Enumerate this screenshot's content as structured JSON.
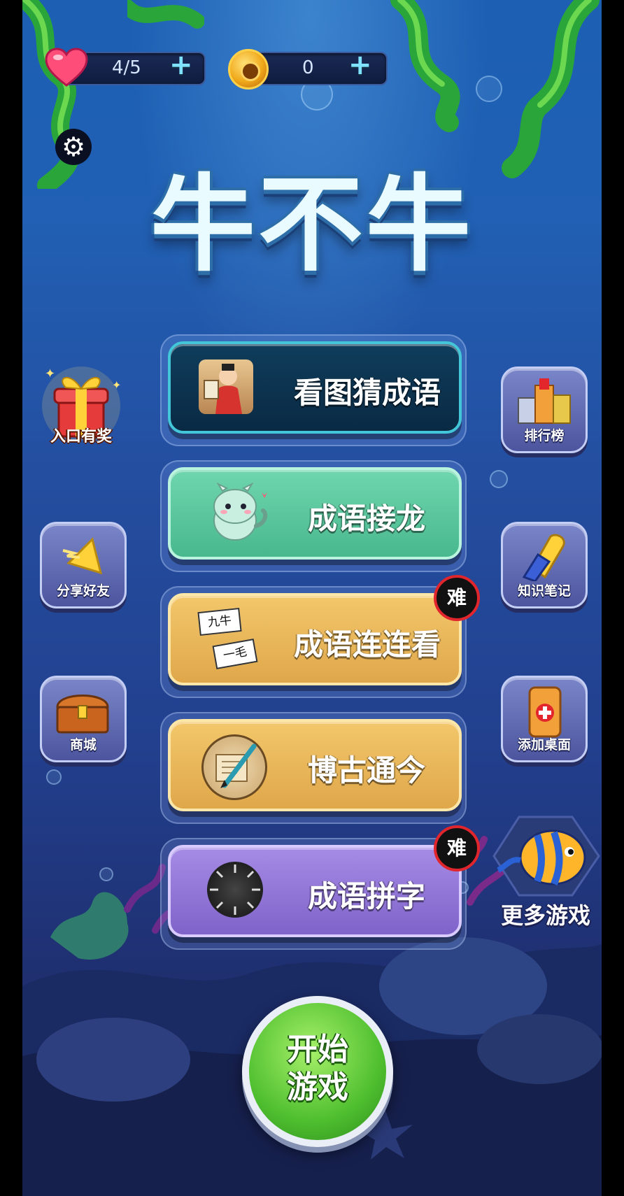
{
  "hud": {
    "lives": "4/5",
    "coins": "0",
    "plus_symbol": "+"
  },
  "title": "牛不牛",
  "settings_icon": "gear-icon",
  "menu": [
    {
      "label": "看图猜成语",
      "icon": "scholar-painting-icon",
      "color": "#0f3d5c"
    },
    {
      "label": "成语接龙",
      "icon": "baby-dragon-icon",
      "color": "#5ec79e"
    },
    {
      "label": "成语连连看",
      "icon": "word-cards-icon",
      "color": "#e9b75a",
      "badge": "难"
    },
    {
      "label": "博古通今",
      "icon": "scroll-brush-icon",
      "color": "#e9b75a"
    },
    {
      "label": "成语拼字",
      "icon": "character-wheel-icon",
      "color": "#9275d8",
      "badge": "难"
    }
  ],
  "word_cards": [
    "九牛",
    "一毛"
  ],
  "side_left": {
    "gift": "入口有奖",
    "share": "分享好友",
    "shop": "商城"
  },
  "side_right": {
    "rank": "排行榜",
    "notes": "知识笔记",
    "desktop": "添加桌面",
    "more": "更多游戏"
  },
  "start_button": "开始游戏",
  "colors": {
    "heart": "#ff4d7a",
    "coin": "#f4b324",
    "badge_border": "#e0262c",
    "start_green": "#4fbf2f"
  }
}
